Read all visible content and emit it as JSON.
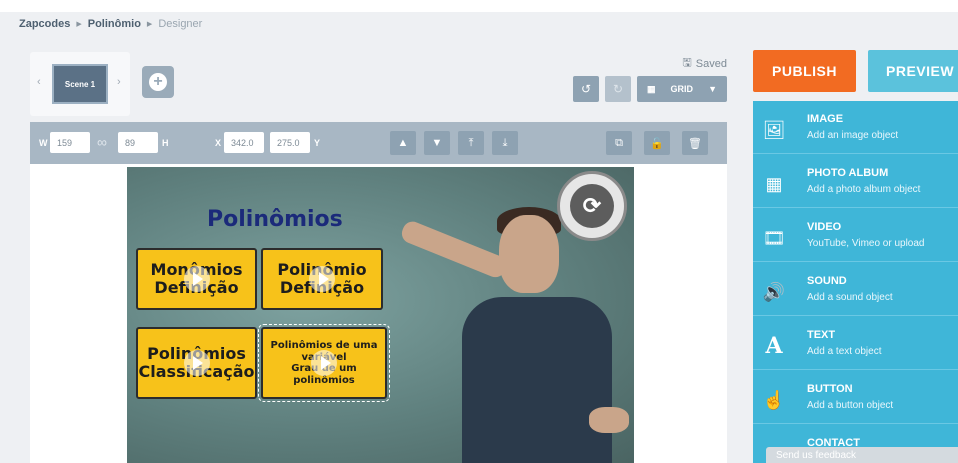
{
  "breadcrumb": [
    "Zapcodes",
    "Polinômio",
    "Designer"
  ],
  "scenes": {
    "items": [
      "Scene 1"
    ]
  },
  "status": {
    "saved": "Saved"
  },
  "toolbar": {
    "grid_label": "GRID"
  },
  "props": {
    "w_label": "W",
    "w_value": "159",
    "h_label": "H",
    "h_value": "89",
    "x_label": "X",
    "x_value": "342.0",
    "y_label": "Y",
    "y_value": "275.0"
  },
  "stage": {
    "title": "Polinômios",
    "tiles": [
      "Monômios\nDefinição",
      "Polinômio\nDefinição",
      "Polinômios\nClassificação",
      "Polinômios de uma\nvariável\nGrau de um\npolinômios"
    ]
  },
  "actions": {
    "publish": "PUBLISH",
    "preview": "PREVIEW"
  },
  "panel": {
    "items": [
      {
        "icon": "image-icon",
        "title": "IMAGE",
        "subtitle": "Add an image object"
      },
      {
        "icon": "photo-album-icon",
        "title": "PHOTO ALBUM",
        "subtitle": "Add a photo album object"
      },
      {
        "icon": "video-icon",
        "title": "VIDEO",
        "subtitle": "YouTube, Vimeo or upload"
      },
      {
        "icon": "sound-icon",
        "title": "SOUND",
        "subtitle": "Add a sound object"
      },
      {
        "icon": "text-icon",
        "title": "TEXT",
        "subtitle": "Add a text object"
      },
      {
        "icon": "button-icon",
        "title": "BUTTON",
        "subtitle": "Add a button object"
      },
      {
        "icon": "contact-icon",
        "title": "CONTACT",
        "subtitle": ""
      }
    ]
  },
  "feedback": "Send us feedback",
  "colors": {
    "publish": "#f26b22",
    "preview": "#5bc2dc",
    "panel": "#3fb6d8",
    "tile": "#f7c21a"
  }
}
